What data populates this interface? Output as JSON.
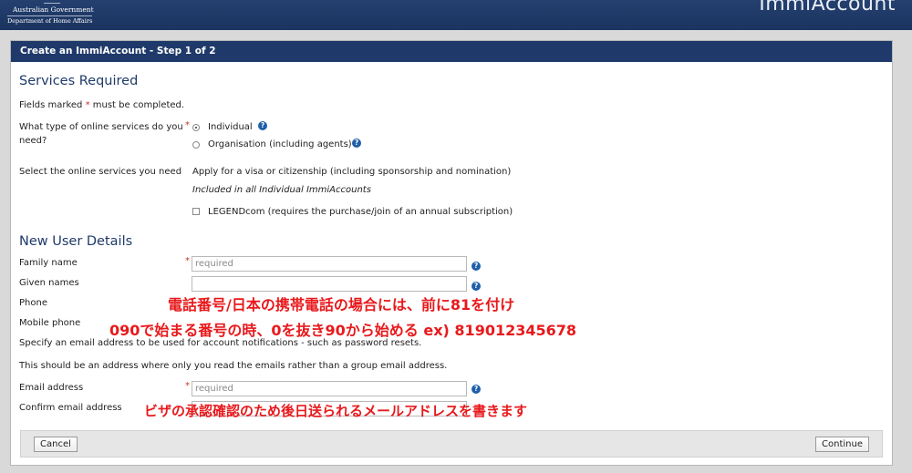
{
  "header": {
    "gov_line1": "Australian Government",
    "gov_line2": "Department of Home Affairs",
    "brand": "ImmiAccount"
  },
  "panel": {
    "title": "Create an ImmiAccount - Step 1 of 2"
  },
  "services": {
    "heading": "Services Required",
    "fields_note_pre": "Fields marked",
    "fields_note_star": "*",
    "fields_note_post": "must be completed.",
    "type_question_l1": "What type of online services do you",
    "type_question_l2": "need?",
    "option_individual": "Individual",
    "option_organisation": "Organisation (including agents)",
    "select_label": "Select the online services you need",
    "apply_text": "Apply for a visa or citizenship (including sponsorship and nomination)",
    "included_text": "Included in all Individual ImmiAccounts",
    "legend_label": "LEGENDcom (requires the purchase/join of an annual subscription)"
  },
  "user": {
    "heading": "New User Details",
    "family_label": "Family name",
    "given_label": "Given names",
    "phone_label": "Phone",
    "mobile_label": "Mobile phone",
    "required_placeholder": "required",
    "email_note1": "Specify an email address to be used for account notifications - such as password resets.",
    "email_note2": "This should be an address where only you read the emails rather than a group email address.",
    "email_label": "Email address",
    "confirm_label": "Confirm email address"
  },
  "footer": {
    "cancel": "Cancel",
    "continue": "Continue"
  },
  "annotations": {
    "a1": "電話番号/日本の携帯電話の場合には、前に81を付け",
    "a2": "090で始まる番号の時、0を抜き90から始める ex) 819012345678",
    "a3": "ビザの承認確認のため後日送られるメールアドレスを書きます"
  },
  "icons": {
    "help": "help-circle-icon"
  },
  "colors": {
    "header_bg": "#1f3a6a",
    "required_star": "#c0392b",
    "annotation": "#e8191c",
    "help_icon": "#1f5fa8"
  }
}
